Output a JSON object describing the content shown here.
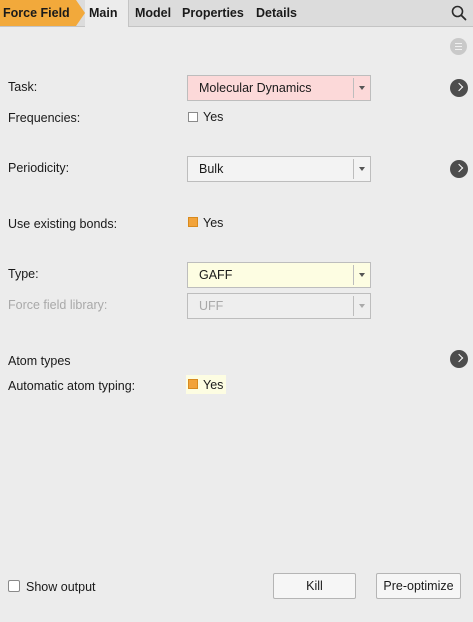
{
  "tabs": {
    "breadcrumb": "Force Field",
    "items": [
      "Main",
      "Model",
      "Properties",
      "Details"
    ]
  },
  "form": {
    "task": {
      "label": "Task:",
      "value": "Molecular Dynamics"
    },
    "frequencies": {
      "label": "Frequencies:",
      "check_label": "Yes",
      "checked": false
    },
    "periodicity": {
      "label": "Periodicity:",
      "value": "Bulk"
    },
    "bonds": {
      "label": "Use existing bonds:",
      "check_label": "Yes",
      "checked": true
    },
    "type": {
      "label": "Type:",
      "value": "GAFF"
    },
    "library": {
      "label": "Force field library:",
      "value": "UFF"
    },
    "atom_types": {
      "label": "Atom types"
    },
    "auto_typing": {
      "label": "Automatic atom typing:",
      "check_label": "Yes",
      "checked": true
    }
  },
  "footer": {
    "show_output": "Show output",
    "kill": "Kill",
    "preoptimize": "Pre-optimize"
  },
  "colors": {
    "accent": "#f2a93b",
    "task_field": "#fcd9d9",
    "type_field": "#fdfde2"
  }
}
